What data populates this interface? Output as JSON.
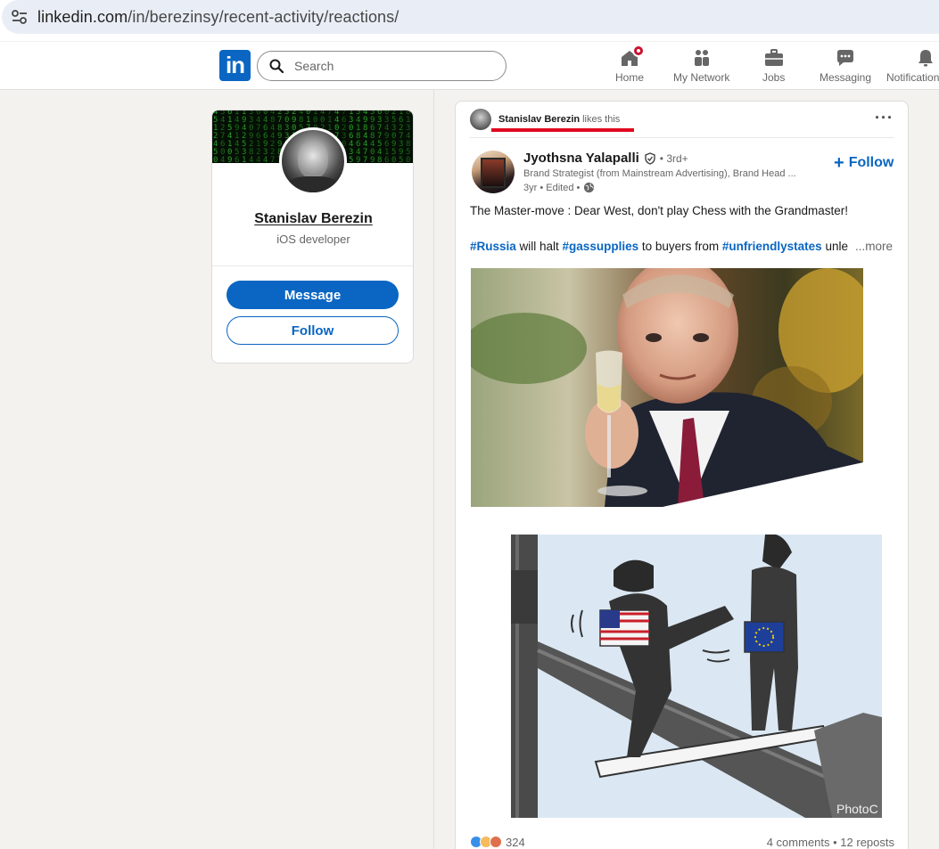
{
  "browser": {
    "url_host": "linkedin.com",
    "url_path": "/in/berezinsy/recent-activity/reactions/"
  },
  "nav": {
    "logo": "in",
    "search_placeholder": "Search",
    "items": [
      {
        "label": "Home",
        "icon": "home-icon",
        "badge": true
      },
      {
        "label": "My Network",
        "icon": "people-icon",
        "badge": false
      },
      {
        "label": "Jobs",
        "icon": "briefcase-icon",
        "badge": false
      },
      {
        "label": "Messaging",
        "icon": "chat-icon",
        "badge": false
      },
      {
        "label": "Notifications",
        "icon": "bell-icon",
        "badge": false
      }
    ]
  },
  "profile": {
    "name": "Stanislav Berezin",
    "title": "iOS developer",
    "message_label": "Message",
    "follow_label": "Follow"
  },
  "post": {
    "activity_actor": "Stanislav Berezin",
    "activity_verb": "likes this",
    "more_label": "···",
    "author": {
      "name": "Jyothsna Yalapalli",
      "degree": "• 3rd+",
      "headline": "Brand Strategist (from Mainstream Advertising), Brand Head ...",
      "meta": "3yr • Edited •",
      "follow_label": "Follow"
    },
    "text_line1": "The Master-move : Dear West, don't play Chess with the Grandmaster!",
    "hashtag1": "#Russia",
    "text_mid1": " will halt ",
    "hashtag2": "#gassupplies",
    "text_mid2": " to buyers from ",
    "hashtag3": "#unfriendlystates",
    "text_tail": " unle",
    "see_more": "...more",
    "watermark": "PhotoC",
    "reactions_count": "324",
    "comments_reposts": "4 comments • 12 reposts"
  },
  "colors": {
    "brand": "#0a66c2",
    "notification": "#cb112d",
    "highlight_underline": "#e0081f"
  }
}
